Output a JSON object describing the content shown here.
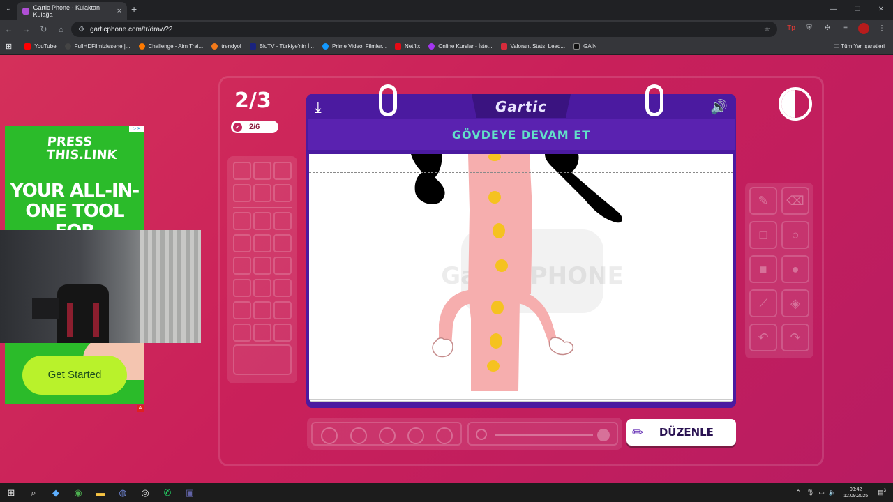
{
  "browser": {
    "tab_title": "Gartic Phone - Kulaktan Kulağa",
    "url": "garticphone.com/tr/draw?2",
    "bookmarks": [
      {
        "label": "YouTube",
        "color": "#ff0000"
      },
      {
        "label": "FullHDFilmizlesene |...",
        "color": "#444444"
      },
      {
        "label": "Challenge - Aim Trai...",
        "color": "#ff7a00"
      },
      {
        "label": "trendyol",
        "color": "#f27a1a"
      },
      {
        "label": "BluTV - Türkiye'nin İ...",
        "color": "#1a237e"
      },
      {
        "label": "Prime Video| Filmler...",
        "color": "#1399ff"
      },
      {
        "label": "Netflix",
        "color": "#e50914"
      },
      {
        "label": "Online Kurslar - İste...",
        "color": "#a435f0"
      },
      {
        "label": "Valorant Stats, Lead...",
        "color": "#d62b3b"
      },
      {
        "label": "GAİN",
        "color": "#111111"
      }
    ],
    "all_bookmarks": "Tüm Yer İşaretleri"
  },
  "game": {
    "round": "2/3",
    "done_count": "2/6",
    "logo": "Gartic",
    "instruction": "GÖVDEYE DEVAM ET",
    "edit_button": "DÜZENLE",
    "watermark": "Gartic PHONE",
    "drawing": {
      "body_color": "#f6aeae",
      "button_color": "#f5c220",
      "arm_color": "#000000"
    }
  },
  "ad": {
    "brand": "PRESS THIS.LINK",
    "headline": "YOUR ALL-IN-ONE TOOL FOR MANAGING LINKS",
    "cta": "Get Started",
    "badge": "A"
  },
  "taskbar": {
    "time": "03:42",
    "date": "12.09.2025",
    "notifications": "3"
  }
}
